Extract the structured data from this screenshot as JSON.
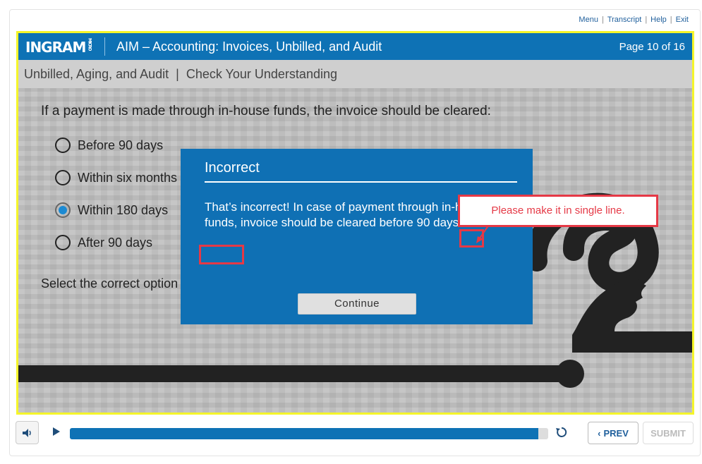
{
  "topnav": {
    "menu": "Menu",
    "transcript": "Transcript",
    "help": "Help",
    "exit": "Exit"
  },
  "header": {
    "logo": "INGRAM",
    "logo_small": "MICRO",
    "title": "AIM – Accounting: Invoices, Unbilled, and Audit",
    "page": "Page 10 of 16"
  },
  "subheader": {
    "text": "Unbilled, Aging, and Audit  |  Check Your Understanding"
  },
  "question": {
    "text": "If a payment is made through in-house funds, the invoice should be cleared:"
  },
  "options": [
    {
      "label": "Before 90 days",
      "selected": false
    },
    {
      "label": "Within six months",
      "selected": false
    },
    {
      "label": "Within 180 days",
      "selected": true
    },
    {
      "label": "After 90 days",
      "selected": false
    }
  ],
  "instruction": "Select the correct option",
  "modal": {
    "title": "Incorrect",
    "body": "That’s incorrect! In case of payment through in-house funds, invoice should be cleared before 90 days.",
    "continue_label": "Continue"
  },
  "annotation": {
    "callout": "Please make it in single line.",
    "color": "#e53946"
  },
  "footer": {
    "prev_label": "PREV",
    "submit_label": "SUBMIT",
    "progress": 0.98
  },
  "colors": {
    "brand_blue": "#0e72b5",
    "highlight_yellow": "#f5f52a"
  }
}
